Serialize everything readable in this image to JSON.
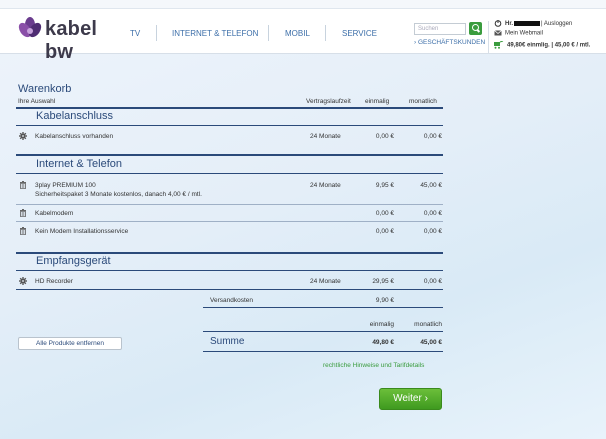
{
  "brand": {
    "name": "kabel bw"
  },
  "nav": {
    "tv": "TV",
    "internet": "INTERNET & TELEFON",
    "mobil": "MOBIL",
    "service": "SERVICE"
  },
  "search": {
    "placeholder": "Suchen"
  },
  "business_link": "› GESCHÄFTSKUNDEN",
  "user": {
    "greeting": "Hr.",
    "logout": "| Ausloggen",
    "webmail": "Mein Webmail",
    "cart_summary": "49,80€ einmlig. | 45,00 € / mtl."
  },
  "cart": {
    "title": "Warenkorb",
    "subtitle": "Ihre Auswahl",
    "columns": {
      "term": "Vertragslaufzeit",
      "once": "einmalig",
      "monthly": "monatlich"
    },
    "sections": [
      {
        "title": "Kabelanschluss",
        "items": [
          {
            "icon": "gear-icon",
            "name": "Kabelanschluss vorhanden",
            "detail": "",
            "term": "24 Monate",
            "once": "0,00 €",
            "monthly": "0,00 €"
          }
        ]
      },
      {
        "title": "Internet & Telefon",
        "items": [
          {
            "icon": "trash-icon",
            "name": "3play PREMIUM 100",
            "detail": "Sicherheitspaket 3 Monate kostenlos, danach 4,00 € / mtl.",
            "term": "24 Monate",
            "once": "9,95 €",
            "monthly": "45,00 €"
          },
          {
            "icon": "trash-icon",
            "name": "Kabelmodem",
            "detail": "",
            "term": "",
            "once": "0,00 €",
            "monthly": "0,00 €"
          },
          {
            "icon": "trash-icon",
            "name": "Kein Modem Installationsservice",
            "detail": "",
            "term": "",
            "once": "0,00 €",
            "monthly": "0,00 €"
          }
        ]
      },
      {
        "title": "Empfangsgerät",
        "items": [
          {
            "icon": "gear-icon",
            "name": "HD Recorder",
            "detail": "",
            "term": "24 Monate",
            "once": "29,95 €",
            "monthly": "0,00 €"
          }
        ]
      }
    ],
    "shipping": {
      "label": "Versandkosten",
      "once": "9,90 €"
    },
    "totals": {
      "once_label": "einmalig",
      "monthly_label": "monatlich",
      "sum_label": "Summe",
      "once": "49,80 €",
      "monthly": "45,00 €"
    },
    "remove_all": "Alle Produkte entfernen",
    "legal_link": "rechtliche Hinweise und Tarifdetails",
    "next_button": "Weiter ›"
  },
  "colors": {
    "brand_blue": "#2b4a7a",
    "green": "#3a9c3e",
    "link_blue": "#3d6fa9"
  }
}
